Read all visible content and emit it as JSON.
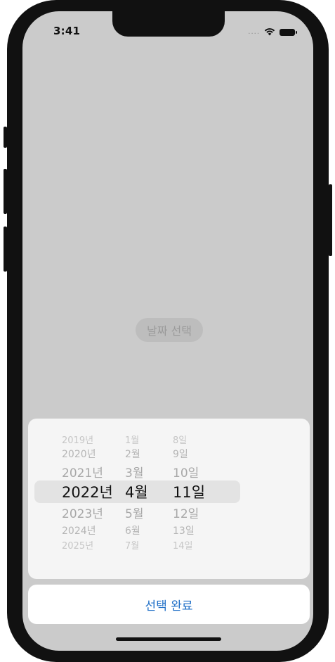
{
  "status_bar": {
    "time": "3:41",
    "signal": "....",
    "icons": [
      "wifi-icon",
      "battery-icon"
    ]
  },
  "main": {
    "button_label": "날짜 선택"
  },
  "picker": {
    "selected": {
      "year": "2022년",
      "month": "4월",
      "day": "11일"
    },
    "rows": [
      {
        "year": "2019년",
        "month": "1월",
        "day": "8일"
      },
      {
        "year": "2020년",
        "month": "2월",
        "day": "9일"
      },
      {
        "year": "2021년",
        "month": "3월",
        "day": "10일"
      },
      {
        "year": "2022년",
        "month": "4월",
        "day": "11일"
      },
      {
        "year": "2023년",
        "month": "5월",
        "day": "12일"
      },
      {
        "year": "2024년",
        "month": "6월",
        "day": "13일"
      },
      {
        "year": "2025년",
        "month": "7월",
        "day": "14일"
      }
    ]
  },
  "done": {
    "label": "선택 완료"
  },
  "colors": {
    "screen_background": "#cbcbcb",
    "sheet_background": "#f5f5f5",
    "accent": "#1f6fc7",
    "selection_band": "#e3e3e3"
  }
}
